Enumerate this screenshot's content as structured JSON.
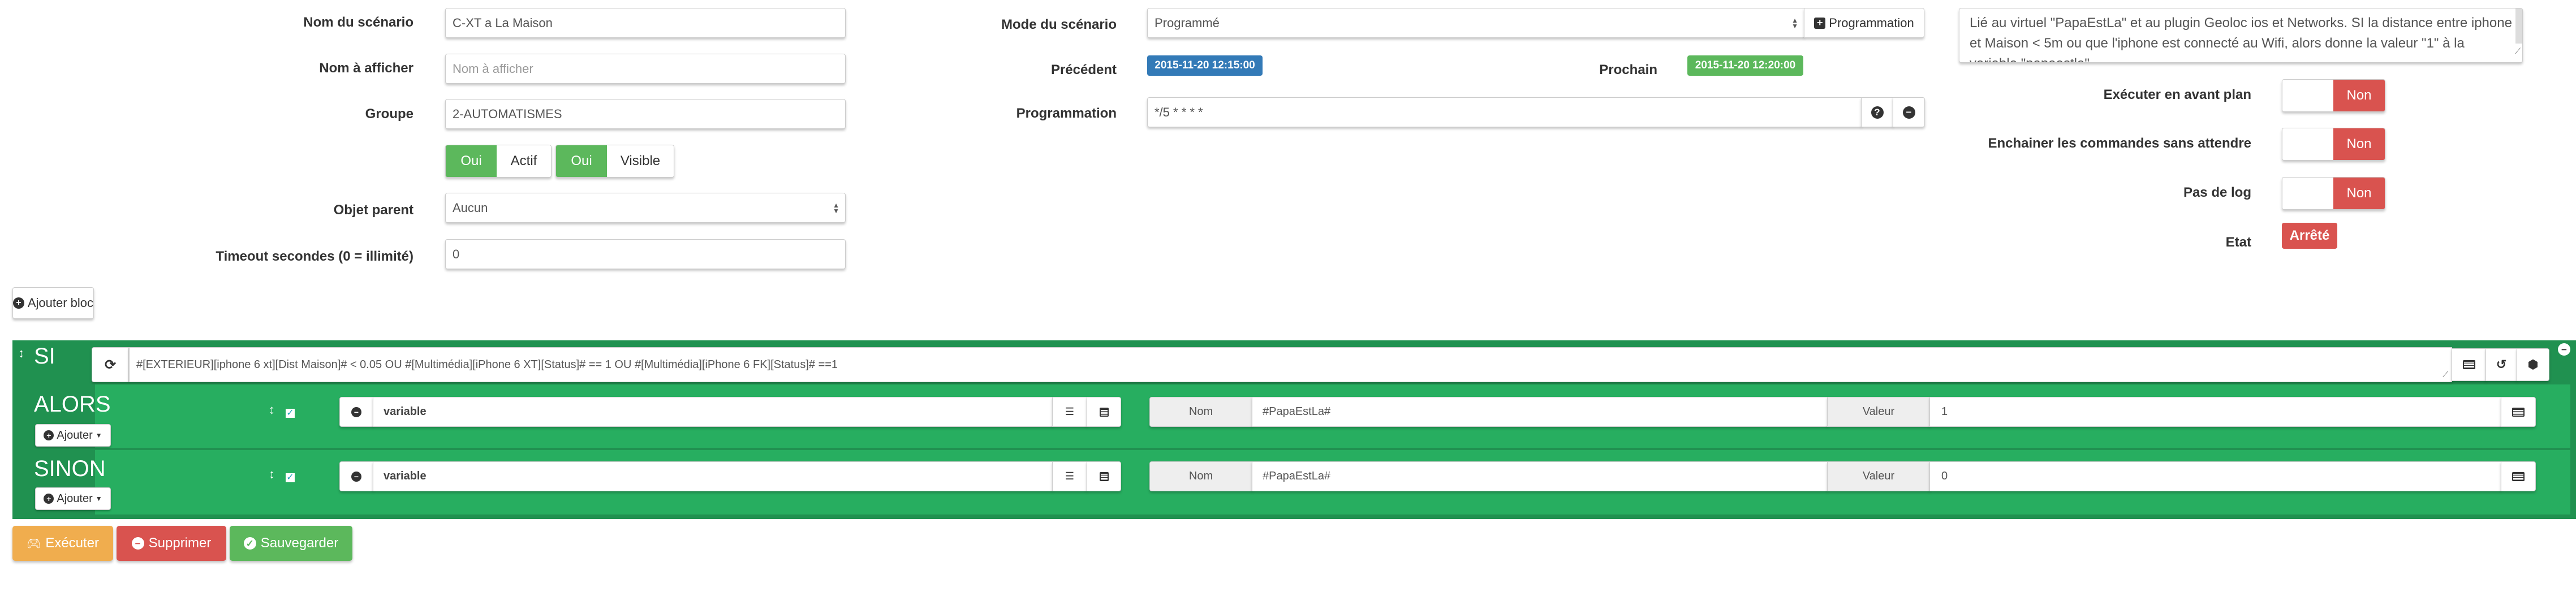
{
  "general": {
    "name_label": "Nom du scénario",
    "name_value": "C-XT a La Maison",
    "display_label": "Nom à afficher",
    "display_placeholder": "Nom à afficher",
    "group_label": "Groupe",
    "group_value": "2-AUTOMATISMES",
    "active_on": "Oui",
    "active_label": "Actif",
    "visible_on": "Oui",
    "visible_label": "Visible",
    "parent_label": "Objet parent",
    "parent_value": "Aucun",
    "timeout_label": "Timeout secondes (0 = illimité)",
    "timeout_value": "0"
  },
  "mode": {
    "mode_label": "Mode du scénario",
    "mode_value": "Programmé",
    "add_prog_label": "Programmation",
    "previous_label": "Précédent",
    "previous_value": "2015-11-20 12:15:00",
    "next_label": "Prochain",
    "next_value": "2015-11-20 12:20:00",
    "prog_label": "Programmation",
    "prog_value": "*/5 * * * *"
  },
  "options": {
    "description": "Lié au virtuel \"PapaEstLa\" et au plugin Geoloc ios et Networks. SI la distance entre iphone et Maison < 5m ou que l'iphone est connecté au Wifi, alors donne la valeur \"1\" à la variable \"papaestla\"",
    "foreground_label": "Exécuter en avant plan",
    "foreground_value": "Non",
    "chain_label": "Enchainer les commandes sans attendre",
    "chain_value": "Non",
    "nolog_label": "Pas de log",
    "nolog_value": "Non",
    "state_label": "Etat",
    "state_value": "Arrêté"
  },
  "add_block_label": "Ajouter bloc",
  "si_block": {
    "title": "SI",
    "condition": "#[EXTERIEUR][iphone 6 xt][Dist Maison]# < 0.05  OU #[Multimédia][iPhone 6 XT][Status]# == 1  OU #[Multimédia][iPhone 6 FK][Status]# ==1"
  },
  "alors_block": {
    "title": "ALORS",
    "add_label": "Ajouter",
    "action": "variable",
    "name_addon": "Nom",
    "name_value": "#PapaEstLa#",
    "value_addon": "Valeur",
    "value_value": "1"
  },
  "sinon_block": {
    "title": "SINON",
    "add_label": "Ajouter",
    "action": "variable",
    "name_addon": "Nom",
    "name_value": "#PapaEstLa#",
    "value_addon": "Valeur",
    "value_value": "0"
  },
  "actions": {
    "execute_label": "Exécuter",
    "delete_label": "Supprimer",
    "save_label": "Sauvegarder"
  },
  "colors": {
    "success": "#5cb85c",
    "danger": "#d9534f",
    "warning": "#f0ad4e",
    "primary": "#337ab7",
    "block_dark": "#209150",
    "block_light": "#27ae60"
  }
}
